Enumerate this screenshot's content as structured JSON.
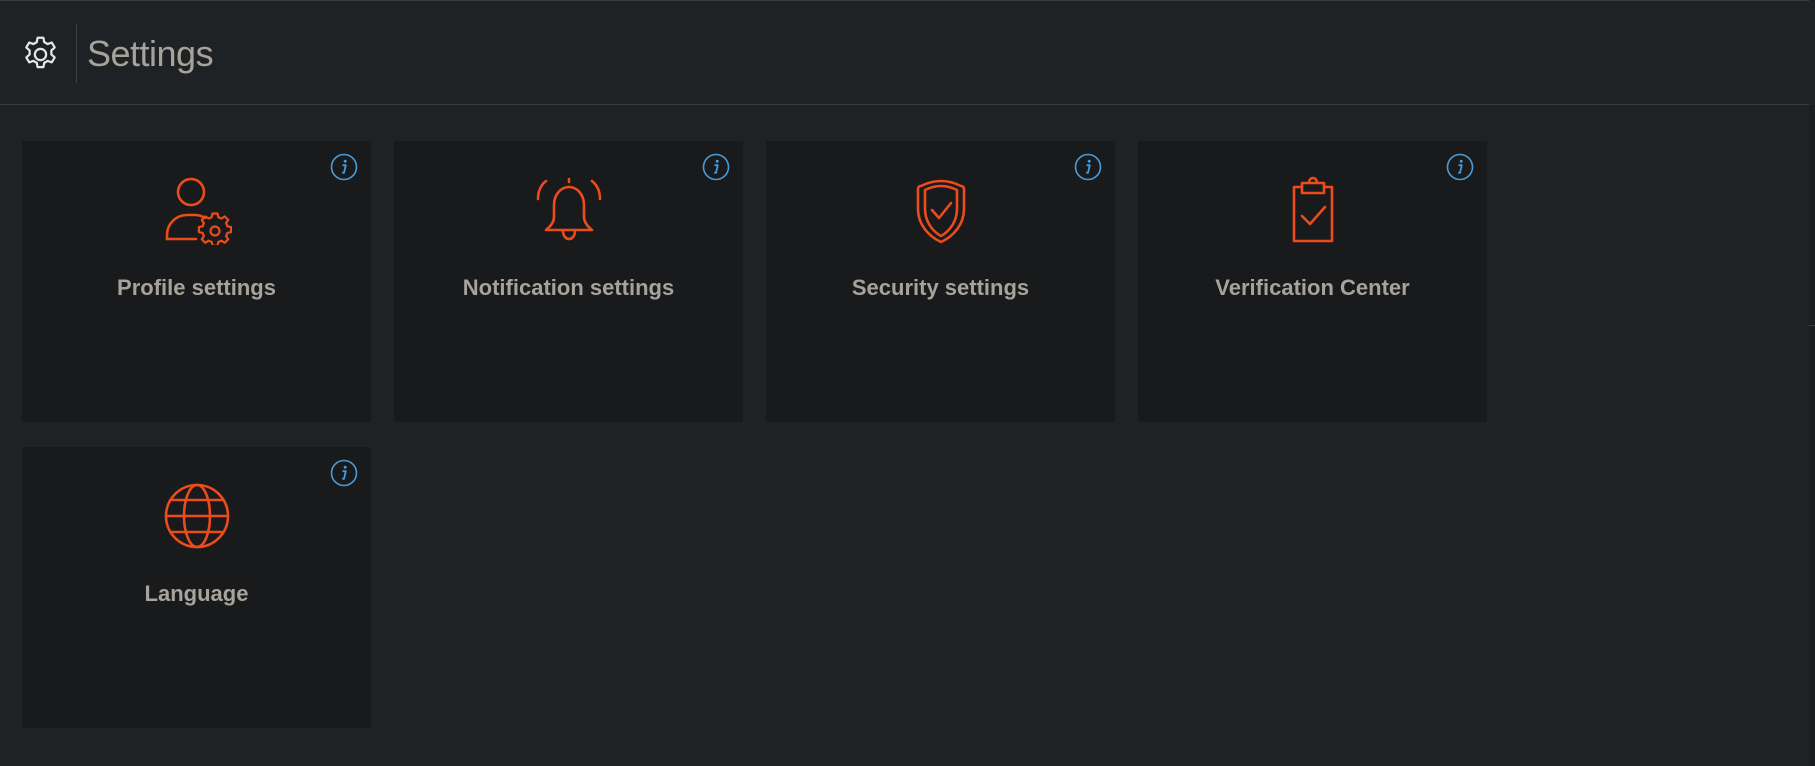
{
  "header": {
    "title": "Settings",
    "icon": "gear-icon"
  },
  "colors": {
    "background": "#1f2224",
    "card": "#181a1c",
    "accent": "#ec4b1b",
    "info": "#4b9bd8",
    "text": "#a7a39a"
  },
  "cards": [
    {
      "label": "Profile settings",
      "icon": "user-gear-icon"
    },
    {
      "label": "Notification settings",
      "icon": "bell-icon"
    },
    {
      "label": "Security settings",
      "icon": "shield-check-icon"
    },
    {
      "label": "Verification Center",
      "icon": "clipboard-check-icon"
    },
    {
      "label": "Language",
      "icon": "globe-icon"
    }
  ]
}
